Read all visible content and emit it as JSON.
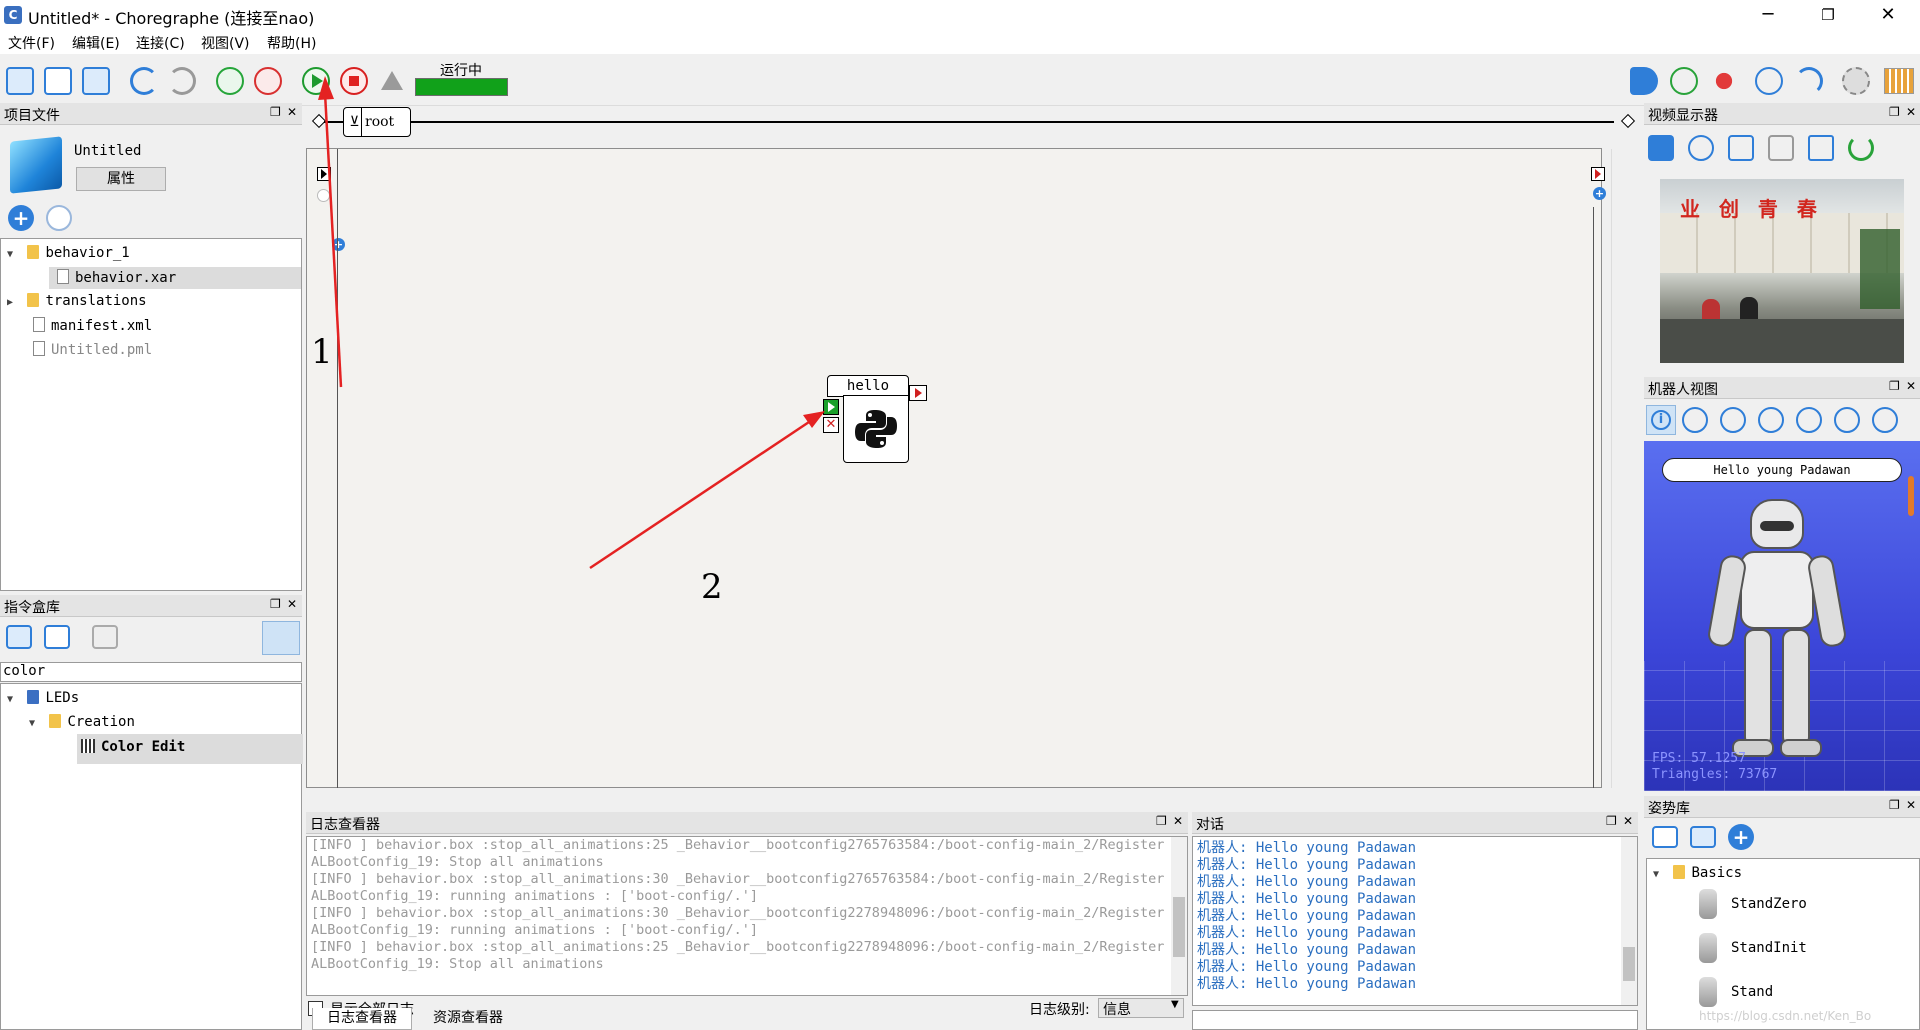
{
  "window": {
    "title": "Untitled* - Choregraphe (连接至nao)",
    "app_icon": "C",
    "minimize": "─",
    "maximize": "❐",
    "close": "✕"
  },
  "menu": [
    "文件(F)",
    "编辑(E)",
    "连接(C)",
    "视图(V)",
    "帮助(H)"
  ],
  "toolbar": {
    "status_label": "运行中",
    "status_progress": 1.0,
    "status_color": "#11a11a"
  },
  "project_panel": {
    "title": "项目文件",
    "project_name": "Untitled",
    "properties_button": "属性",
    "tree": [
      {
        "label": "behavior_1",
        "type": "folder",
        "expanded": true
      },
      {
        "label": "behavior.xar",
        "type": "file",
        "selected": true
      },
      {
        "label": "translations",
        "type": "folder",
        "expanded": false
      },
      {
        "label": "manifest.xml",
        "type": "file"
      },
      {
        "label": "Untitled.pml",
        "type": "file",
        "dim": true
      }
    ]
  },
  "box_library": {
    "title": "指令盒库",
    "search_value": "color",
    "tree": [
      {
        "label": "LEDs"
      },
      {
        "label": "Creation"
      },
      {
        "label": "Color Edit"
      }
    ]
  },
  "flow": {
    "breadcrumb": "root",
    "box_title": "hello",
    "annotations": [
      "1",
      "2"
    ]
  },
  "log_viewer": {
    "title": "日志查看器",
    "lines": [
      "[INFO ] behavior.box :stop_all_animations:25 _Behavior__bootconfig2765763584:/boot-config-main_2/Register",
      "ALBootConfig_19: Stop all animations",
      "[INFO ] behavior.box :stop_all_animations:30 _Behavior__bootconfig2765763584:/boot-config-main_2/Register",
      "ALBootConfig_19: running animations : ['boot-config/.']",
      "[INFO ] behavior.box :stop_all_animations:30 _Behavior__bootconfig2278948096:/boot-config-main_2/Register",
      "ALBootConfig_19: running animations : ['boot-config/.']",
      "[INFO ] behavior.box :stop_all_animations:25 _Behavior__bootconfig2278948096:/boot-config-main_2/Register",
      "ALBootConfig_19: Stop all animations"
    ],
    "show_all_label": "显示全部日志",
    "level_label": "日志级别:",
    "level_value": "信息",
    "tabs": [
      "日志查看器",
      "资源查看器"
    ]
  },
  "dialog": {
    "title": "对话",
    "lines": [
      "机器人: Hello young Padawan",
      "机器人: Hello young Padawan",
      "机器人: Hello young Padawan",
      "机器人: Hello young Padawan",
      "机器人: Hello young Padawan",
      "机器人: Hello young Padawan",
      "机器人: Hello young Padawan",
      "机器人: Hello young Padawan",
      "机器人: Hello young Padawan"
    ]
  },
  "video_panel": {
    "title": "视频显示器",
    "sign_text": "业  创 青 春"
  },
  "robot_view": {
    "title": "机器人视图",
    "speech": "Hello young Padawan",
    "fps": "FPS: 57.1257",
    "triangles": "Triangles: 73767"
  },
  "pose_library": {
    "title": "姿势库",
    "group": "Basics",
    "poses": [
      "StandZero",
      "StandInit",
      "Stand"
    ],
    "watermark": "https://blog.csdn.net/Ken_Bo"
  }
}
